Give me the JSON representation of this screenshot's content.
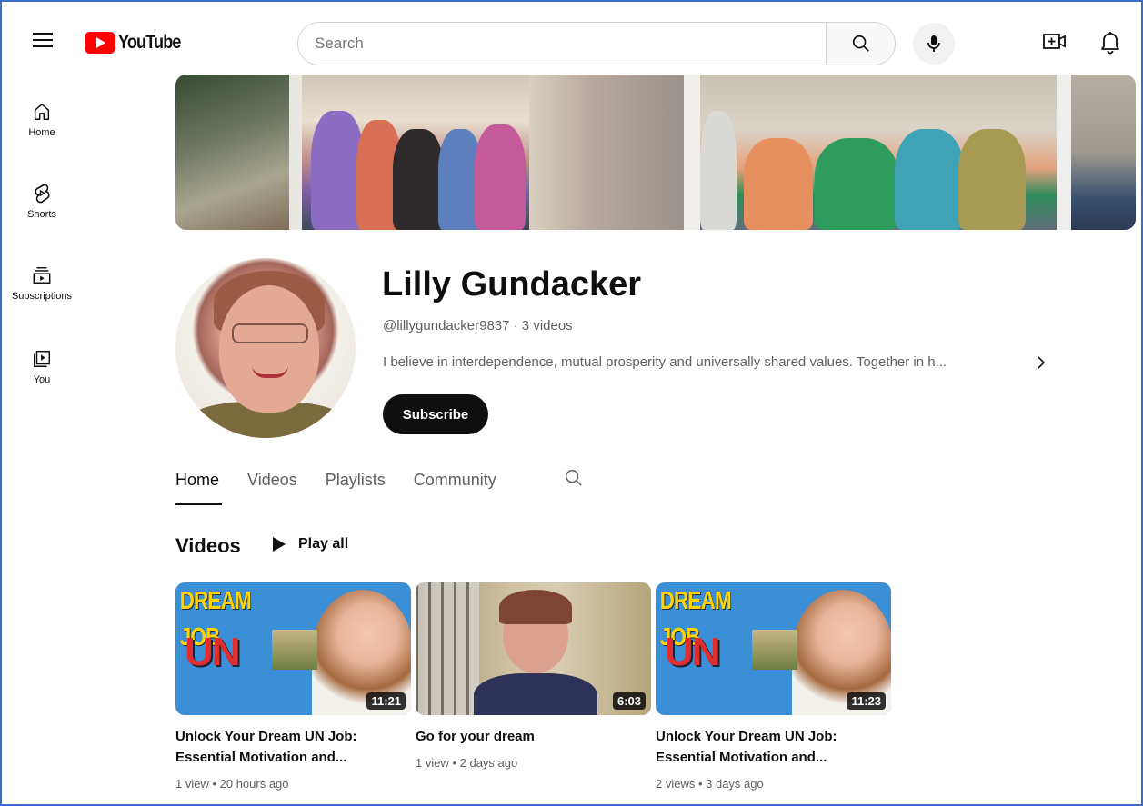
{
  "header": {
    "logo_text": "YouTube",
    "search_placeholder": "Search"
  },
  "sidebar": {
    "items": [
      {
        "label": "Home",
        "icon": "home-icon"
      },
      {
        "label": "Shorts",
        "icon": "shorts-icon"
      },
      {
        "label": "Subscriptions",
        "icon": "subscriptions-icon"
      },
      {
        "label": "You",
        "icon": "you-icon"
      }
    ]
  },
  "channel": {
    "name": "Lilly Gundacker",
    "handle_line": "@lillygundacker9837 · 3 videos",
    "description": "I believe in interdependence, mutual prosperity and universally shared values. Together in h...",
    "subscribe_label": "Subscribe"
  },
  "tabs": [
    {
      "label": "Home",
      "active": true
    },
    {
      "label": "Videos",
      "active": false
    },
    {
      "label": "Playlists",
      "active": false
    },
    {
      "label": "Community",
      "active": false
    }
  ],
  "videos_section": {
    "title": "Videos",
    "play_all_label": "Play all",
    "items": [
      {
        "thumb_text_top": "DREAM JOB",
        "thumb_text_main": "UN",
        "duration": "11:21",
        "title_line1": "Unlock Your Dream UN Job:",
        "title_line2": "Essential Motivation and...",
        "meta": "1 view • 20 hours ago"
      },
      {
        "duration": "6:03",
        "title_line1": "Go for your dream",
        "title_line2": "",
        "meta": "1 view • 2 days ago"
      },
      {
        "thumb_text_top": "DREAM JOB",
        "thumb_text_main": "UN",
        "duration": "11:23",
        "title_line1": "Unlock Your Dream UN Job:",
        "title_line2": "Essential Motivation and...",
        "meta": "2 views • 3 days ago"
      }
    ]
  },
  "colors": {
    "brand_red": "#ff0000",
    "text_primary": "#0f0f0f",
    "text_secondary": "#606060",
    "subscribe_bg": "#0f0f0f"
  }
}
